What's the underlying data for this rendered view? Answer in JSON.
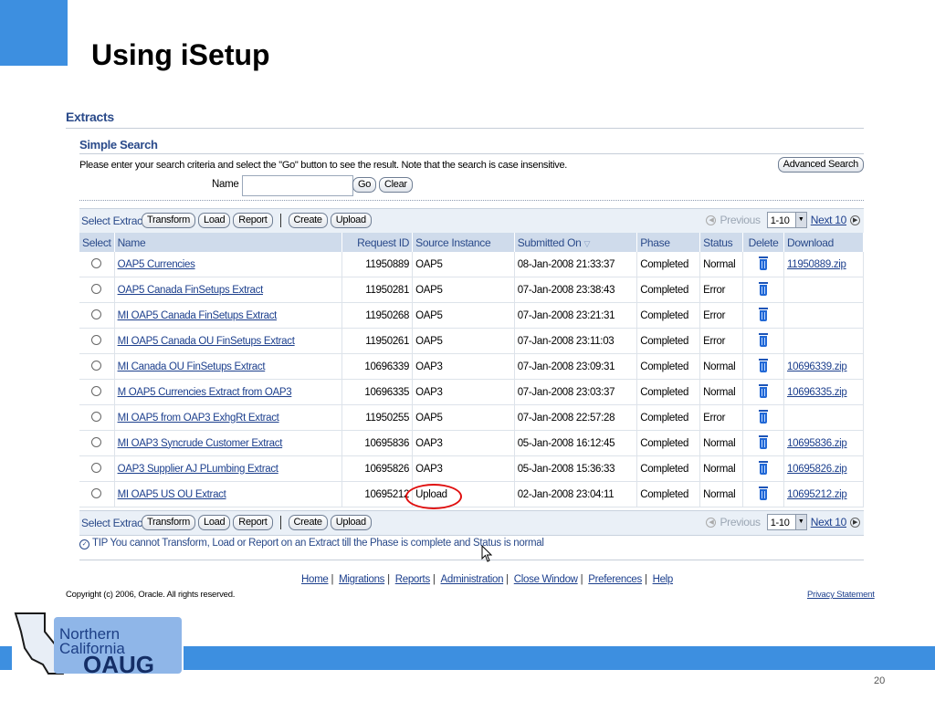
{
  "slide": {
    "title": "Using iSetup",
    "page_number": "20"
  },
  "extracts": {
    "heading": "Extracts",
    "search": {
      "heading": "Simple Search",
      "instructions": "Please enter your search criteria and select the \"Go\" button to see the result. Note that the search is case insensitive.",
      "advanced_label": "Advanced Search",
      "name_label": "Name",
      "name_value": "",
      "go_label": "Go",
      "clear_label": "Clear"
    },
    "toolbar": {
      "label": "Select Extract:",
      "transform": "Transform",
      "load": "Load",
      "report": "Report",
      "create": "Create",
      "upload": "Upload",
      "previous": "Previous",
      "range": "1-10",
      "next": "Next 10"
    },
    "table": {
      "headers": {
        "select": "Select",
        "name": "Name",
        "request_id": "Request ID",
        "source": "Source Instance",
        "submitted": "Submitted On",
        "phase": "Phase",
        "status": "Status",
        "delete": "Delete",
        "download": "Download"
      },
      "rows": [
        {
          "name": "OAP5 Currencies",
          "request_id": "11950889",
          "source": "OAP5",
          "submitted": "08-Jan-2008 21:33:37",
          "phase": "Completed",
          "status": "Normal",
          "download": "11950889.zip"
        },
        {
          "name": "OAP5 Canada FinSetups Extract",
          "request_id": "11950281",
          "source": "OAP5",
          "submitted": "07-Jan-2008 23:38:43",
          "phase": "Completed",
          "status": "Error",
          "download": ""
        },
        {
          "name": "MI OAP5 Canada FinSetups Extract",
          "request_id": "11950268",
          "source": "OAP5",
          "submitted": "07-Jan-2008 23:21:31",
          "phase": "Completed",
          "status": "Error",
          "download": ""
        },
        {
          "name": "MI OAP5 Canada OU FinSetups Extract",
          "request_id": "11950261",
          "source": "OAP5",
          "submitted": "07-Jan-2008 23:11:03",
          "phase": "Completed",
          "status": "Error",
          "download": ""
        },
        {
          "name": "MI Canada OU FinSetups Extract",
          "request_id": "10696339",
          "source": "OAP3",
          "submitted": "07-Jan-2008 23:09:31",
          "phase": "Completed",
          "status": "Normal",
          "download": "10696339.zip"
        },
        {
          "name": "M OAP5 Currencies Extract from OAP3",
          "request_id": "10696335",
          "source": "OAP3",
          "submitted": "07-Jan-2008 23:03:37",
          "phase": "Completed",
          "status": "Normal",
          "download": "10696335.zip"
        },
        {
          "name": "MI OAP5 from OAP3 ExhgRt Extract",
          "request_id": "11950255",
          "source": "OAP5",
          "submitted": "07-Jan-2008 22:57:28",
          "phase": "Completed",
          "status": "Error",
          "download": ""
        },
        {
          "name": "MI OAP3 Syncrude Customer Extract",
          "request_id": "10695836",
          "source": "OAP3",
          "submitted": "05-Jan-2008 16:12:45",
          "phase": "Completed",
          "status": "Normal",
          "download": "10695836.zip"
        },
        {
          "name": "OAP3 Supplier AJ PLumbing Extract",
          "request_id": "10695826",
          "source": "OAP3",
          "submitted": "05-Jan-2008 15:36:33",
          "phase": "Completed",
          "status": "Normal",
          "download": "10695826.zip"
        },
        {
          "name": "MI OAP5 US OU Extract",
          "request_id": "10695212",
          "source": "Upload",
          "submitted": "02-Jan-2008 23:04:11",
          "phase": "Completed",
          "status": "Normal",
          "download": "10695212.zip"
        }
      ]
    },
    "tip": {
      "label": "TIP",
      "text": "You cannot Transform, Load or Report on an Extract till the Phase is complete and Status is normal"
    }
  },
  "footer": {
    "links": [
      "Home",
      "Migrations",
      "Reports",
      "Administration",
      "Close Window",
      "Preferences",
      "Help"
    ],
    "copyright": "Copyright (c) 2006, Oracle. All rights reserved.",
    "privacy": "Privacy Statement"
  },
  "logo": {
    "line1": "Northern",
    "line2": "California",
    "line3": "OAUG"
  },
  "colors": {
    "accent_blue": "#3d8fe0",
    "header_blue": "#2a4a8a",
    "link_blue": "#1c3f8d",
    "highlight_red": "#e01010"
  }
}
